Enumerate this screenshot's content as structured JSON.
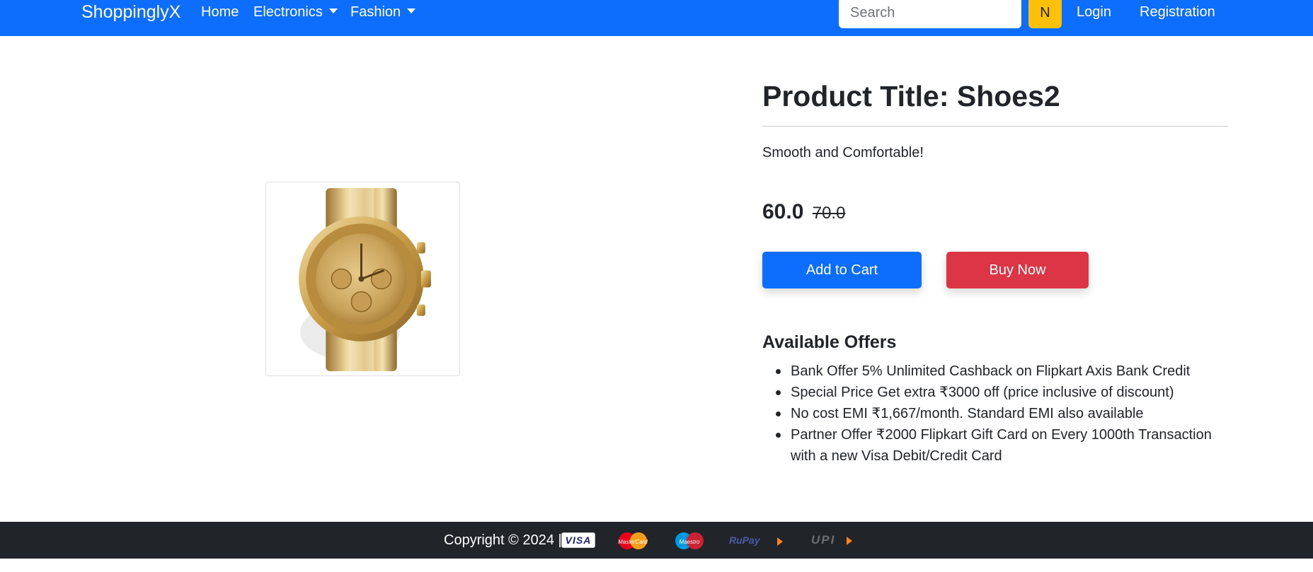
{
  "navbar": {
    "brand": "ShoppinglyX",
    "links": [
      {
        "label": "Home"
      },
      {
        "label": "Electronics"
      },
      {
        "label": "Fashion"
      }
    ],
    "search_placeholder": "Search",
    "search_button": "N",
    "login": "Login",
    "registration": "Registration",
    "color": "#0d6efd"
  },
  "product": {
    "image_icon": "gold-wristwatch",
    "title": "Product Title: Shoes2",
    "description": "Smooth and Comfortable!",
    "price": "60.0",
    "old_price": "70.0",
    "add_to_cart": "Add to Cart",
    "buy_now": "Buy Now"
  },
  "offers": {
    "heading": "Available Offers",
    "items": [
      "Bank Offer 5% Unlimited Cashback on Flipkart Axis Bank Credit",
      "Special Price Get extra ₹3000 off (price inclusive of discount)",
      "No cost EMI ₹1,667/month. Standard EMI also available",
      "Partner Offer ₹2000 Flipkart Gift Card on Every 1000th Transaction with a new Visa Debit/Credit Card"
    ]
  },
  "footer": {
    "copyright": "Copyright © 2024 ||",
    "payment_methods": [
      "VISA",
      "MasterCard",
      "Maestro",
      "RuPay",
      "UPI"
    ]
  }
}
